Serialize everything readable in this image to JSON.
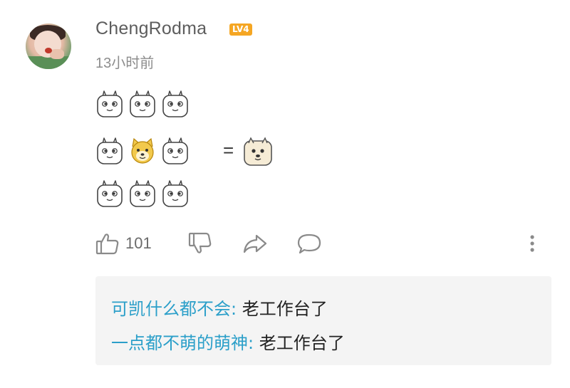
{
  "comment": {
    "username": "ChengRodma",
    "level_badge": "LV4",
    "timestamp": "13小时前",
    "emoji_rows": [
      [
        "white-bunny-emoji",
        "white-bunny-emoji",
        "white-bunny-emoji"
      ],
      [
        "white-bunny-emoji",
        "yellow-doge-emoji",
        "white-bunny-emoji"
      ],
      [
        "white-bunny-emoji",
        "white-bunny-emoji",
        "white-bunny-emoji"
      ]
    ],
    "equals_sign": "=",
    "result_emoji": "cream-doge-emoji"
  },
  "actions": {
    "like_icon": "thumbs-up-icon",
    "like_count": "101",
    "dislike_icon": "thumbs-down-icon",
    "share_icon": "share-icon",
    "reply_icon": "comment-bubble-icon",
    "more_icon": "more-vertical-icon"
  },
  "replies": [
    {
      "name": "可凯什么都不会",
      "separator": ":",
      "text": " 老工作台了"
    },
    {
      "name": "一点都不萌的萌神",
      "separator": ":",
      "text": " 老工作台了"
    }
  ],
  "colors": {
    "reply_name": "#2b9fc9",
    "badge": "#f5a623",
    "username": "#5d5d5d",
    "timestamp": "#8d8d8d"
  }
}
